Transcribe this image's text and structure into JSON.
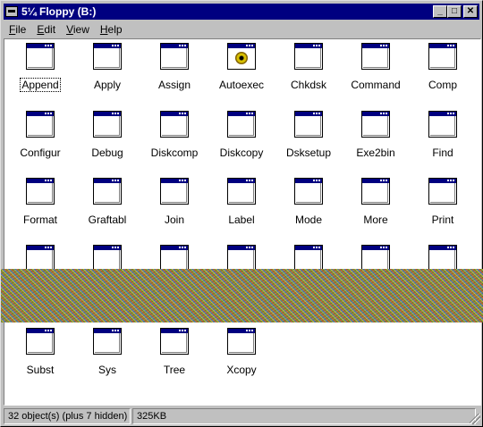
{
  "window": {
    "title": "5¼ Floppy (B:)",
    "buttons": {
      "minimize": "_",
      "maximize": "□",
      "close": "✕"
    }
  },
  "menu": [
    {
      "underline": "F",
      "rest": "ile"
    },
    {
      "underline": "E",
      "rest": "dit"
    },
    {
      "underline": "V",
      "rest": "iew"
    },
    {
      "underline": "H",
      "rest": "elp"
    }
  ],
  "files": [
    {
      "label": "Append",
      "icon": "window-app-icon",
      "selected": true
    },
    {
      "label": "Apply",
      "icon": "window-app-icon"
    },
    {
      "label": "Assign",
      "icon": "window-app-icon"
    },
    {
      "label": "Autoexec",
      "icon": "batch-gear-icon"
    },
    {
      "label": "Chkdsk",
      "icon": "window-app-icon"
    },
    {
      "label": "Command",
      "icon": "window-app-icon"
    },
    {
      "label": "Comp",
      "icon": "window-app-icon"
    },
    {
      "label": "Configur",
      "icon": "window-app-icon"
    },
    {
      "label": "Debug",
      "icon": "window-app-icon"
    },
    {
      "label": "Diskcomp",
      "icon": "window-app-icon"
    },
    {
      "label": "Diskcopy",
      "icon": "window-app-icon"
    },
    {
      "label": "Dsksetup",
      "icon": "window-app-icon"
    },
    {
      "label": "Exe2bin",
      "icon": "window-app-icon"
    },
    {
      "label": "Find",
      "icon": "window-app-icon"
    },
    {
      "label": "Format",
      "icon": "window-app-icon"
    },
    {
      "label": "Graftabl",
      "icon": "window-app-icon"
    },
    {
      "label": "Join",
      "icon": "window-app-icon"
    },
    {
      "label": "Label",
      "icon": "window-app-icon"
    },
    {
      "label": "Mode",
      "icon": "window-app-icon"
    },
    {
      "label": "More",
      "icon": "window-app-icon"
    },
    {
      "label": "Print",
      "icon": "window-app-icon"
    },
    {
      "label": "",
      "icon": "window-app-icon"
    },
    {
      "label": "",
      "icon": "window-app-icon"
    },
    {
      "label": "",
      "icon": "window-app-icon"
    },
    {
      "label": "",
      "icon": "window-app-icon"
    },
    {
      "label": "",
      "icon": "window-app-icon"
    },
    {
      "label": "",
      "icon": "window-app-icon"
    },
    {
      "label": "",
      "icon": "window-app-icon"
    },
    {
      "label": "Subst",
      "icon": "window-app-icon"
    },
    {
      "label": "Sys",
      "icon": "window-app-icon"
    },
    {
      "label": "Tree",
      "icon": "window-app-icon"
    },
    {
      "label": "Xcopy",
      "icon": "window-app-icon"
    }
  ],
  "status": {
    "objects": "32 object(s) (plus 7 hidden)",
    "size": "325KB"
  },
  "colors": {
    "titlebar": "#000080",
    "face": "#c0c0c0",
    "content": "#ffffff"
  }
}
